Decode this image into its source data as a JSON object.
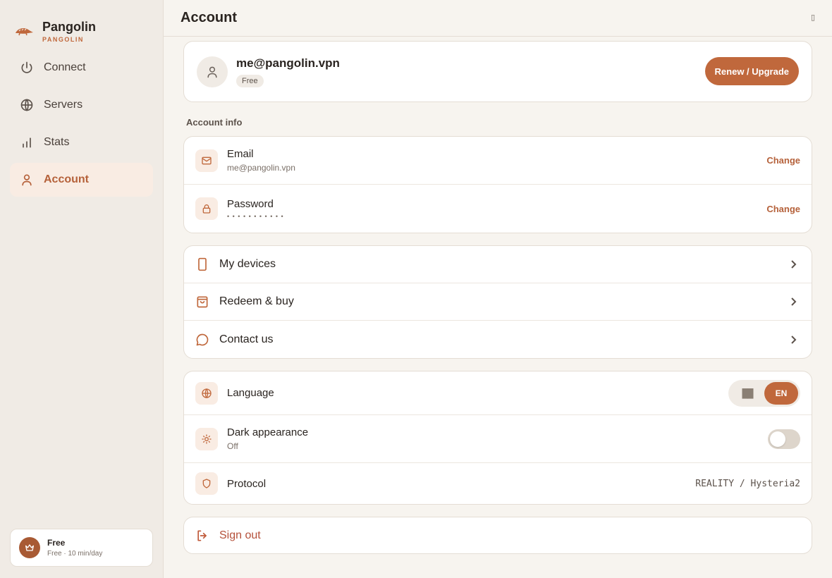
{
  "brand": {
    "name": "Pangolin",
    "subtitle": "PANGOLIN"
  },
  "sidebar": {
    "items": [
      {
        "label": "Connect",
        "icon": "power-icon"
      },
      {
        "label": "Servers",
        "icon": "globe-icon"
      },
      {
        "label": "Stats",
        "icon": "bar-chart-icon"
      },
      {
        "label": "Account",
        "icon": "user-icon",
        "active": true
      }
    ],
    "plan": {
      "title": "Free",
      "subtitle": "Free · 10 min/day"
    }
  },
  "header": {
    "title": "Account",
    "corner": "▯"
  },
  "profile": {
    "email": "me@pangolin.vpn",
    "tier": "Free",
    "upgrade_label": "Renew / Upgrade"
  },
  "account_info": {
    "section_label": "Account info",
    "email": {
      "label": "Email",
      "value": "me@pangolin.vpn",
      "action": "Change"
    },
    "password": {
      "label": "Password",
      "value": "• • • • • • • • • • •",
      "action": "Change"
    }
  },
  "links": [
    {
      "label": "My devices"
    },
    {
      "label": "Redeem & buy"
    },
    {
      "label": "Contact us"
    }
  ],
  "settings": {
    "language": {
      "label": "Language",
      "options": [
        "██",
        "EN"
      ],
      "selected": "EN"
    },
    "dark": {
      "label": "Dark appearance",
      "state": "Off"
    },
    "protocol": {
      "label": "Protocol",
      "value": "REALITY / Hysteria2"
    }
  },
  "signout": {
    "label": "Sign out"
  },
  "colors": {
    "accent": "#c0683c",
    "accent_dark": "#a85a34",
    "background": "#f7f4ef",
    "sidebar": "#f0ebe5",
    "danger": "#b5503a"
  }
}
